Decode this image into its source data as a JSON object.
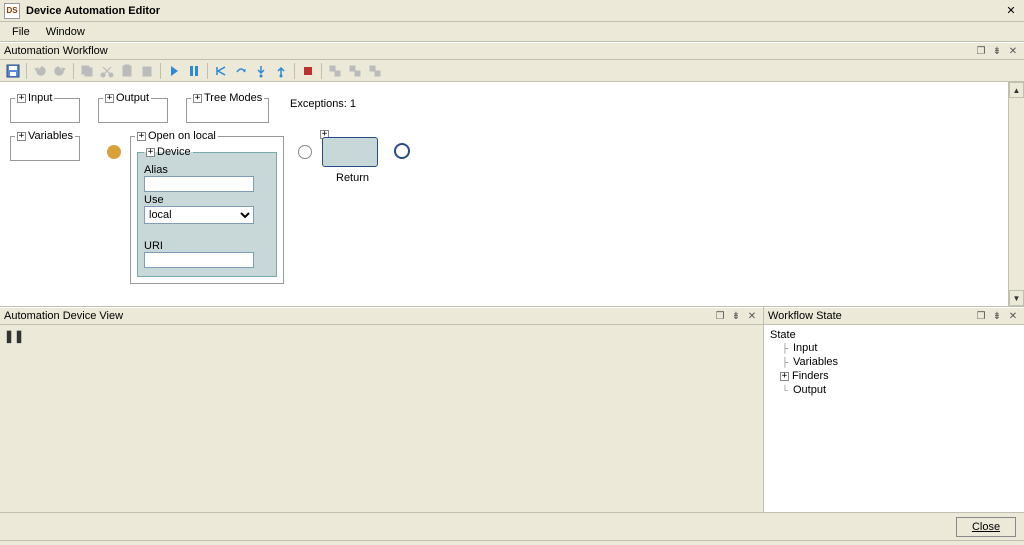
{
  "window": {
    "app_icon_text": "DS",
    "title": "Device Automation Editor",
    "close_glyph": "✕"
  },
  "menu": {
    "file": "File",
    "window": "Window"
  },
  "panels": {
    "workflow": {
      "title": "Automation Workflow"
    },
    "device_view": {
      "title": "Automation Device View"
    },
    "state": {
      "title": "Workflow State"
    }
  },
  "toolbar": {
    "icons": [
      "save-icon",
      "sep",
      "undo-icon",
      "redo-icon",
      "sep",
      "copy-icon",
      "cut-icon",
      "paste-icon",
      "delete-icon",
      "sep",
      "play-icon",
      "pause-icon",
      "sep",
      "step-back-icon",
      "step-over-icon",
      "step-into-icon",
      "step-out-icon",
      "sep",
      "stop-icon",
      "sep",
      "group1-icon",
      "group2-icon",
      "group3-icon"
    ]
  },
  "workflow": {
    "nodes": {
      "input": "Input",
      "output": "Output",
      "tree_modes": "Tree Modes",
      "variables": "Variables",
      "open_on_local": "Open on local",
      "device": "Device"
    },
    "device_fields": {
      "alias_label": "Alias",
      "alias_value": "",
      "use_label": "Use",
      "use_value": "local",
      "use_options": [
        "local"
      ],
      "uri_label": "URI",
      "uri_value": ""
    },
    "return_label": "Return",
    "exceptions_label": "Exceptions: 1",
    "expand_glyph": "+"
  },
  "device_view": {
    "pause_glyph": "❚❚"
  },
  "state_tree": {
    "root": "State",
    "items": [
      {
        "label": "Input",
        "expandable": false
      },
      {
        "label": "Variables",
        "expandable": false
      },
      {
        "label": "Finders",
        "expandable": true,
        "glyph": "+"
      },
      {
        "label": "Output",
        "expandable": false
      }
    ]
  },
  "footer": {
    "close": "Close"
  },
  "panel_icons": {
    "restore": "❐",
    "pin": "📌",
    "close": "✕"
  }
}
